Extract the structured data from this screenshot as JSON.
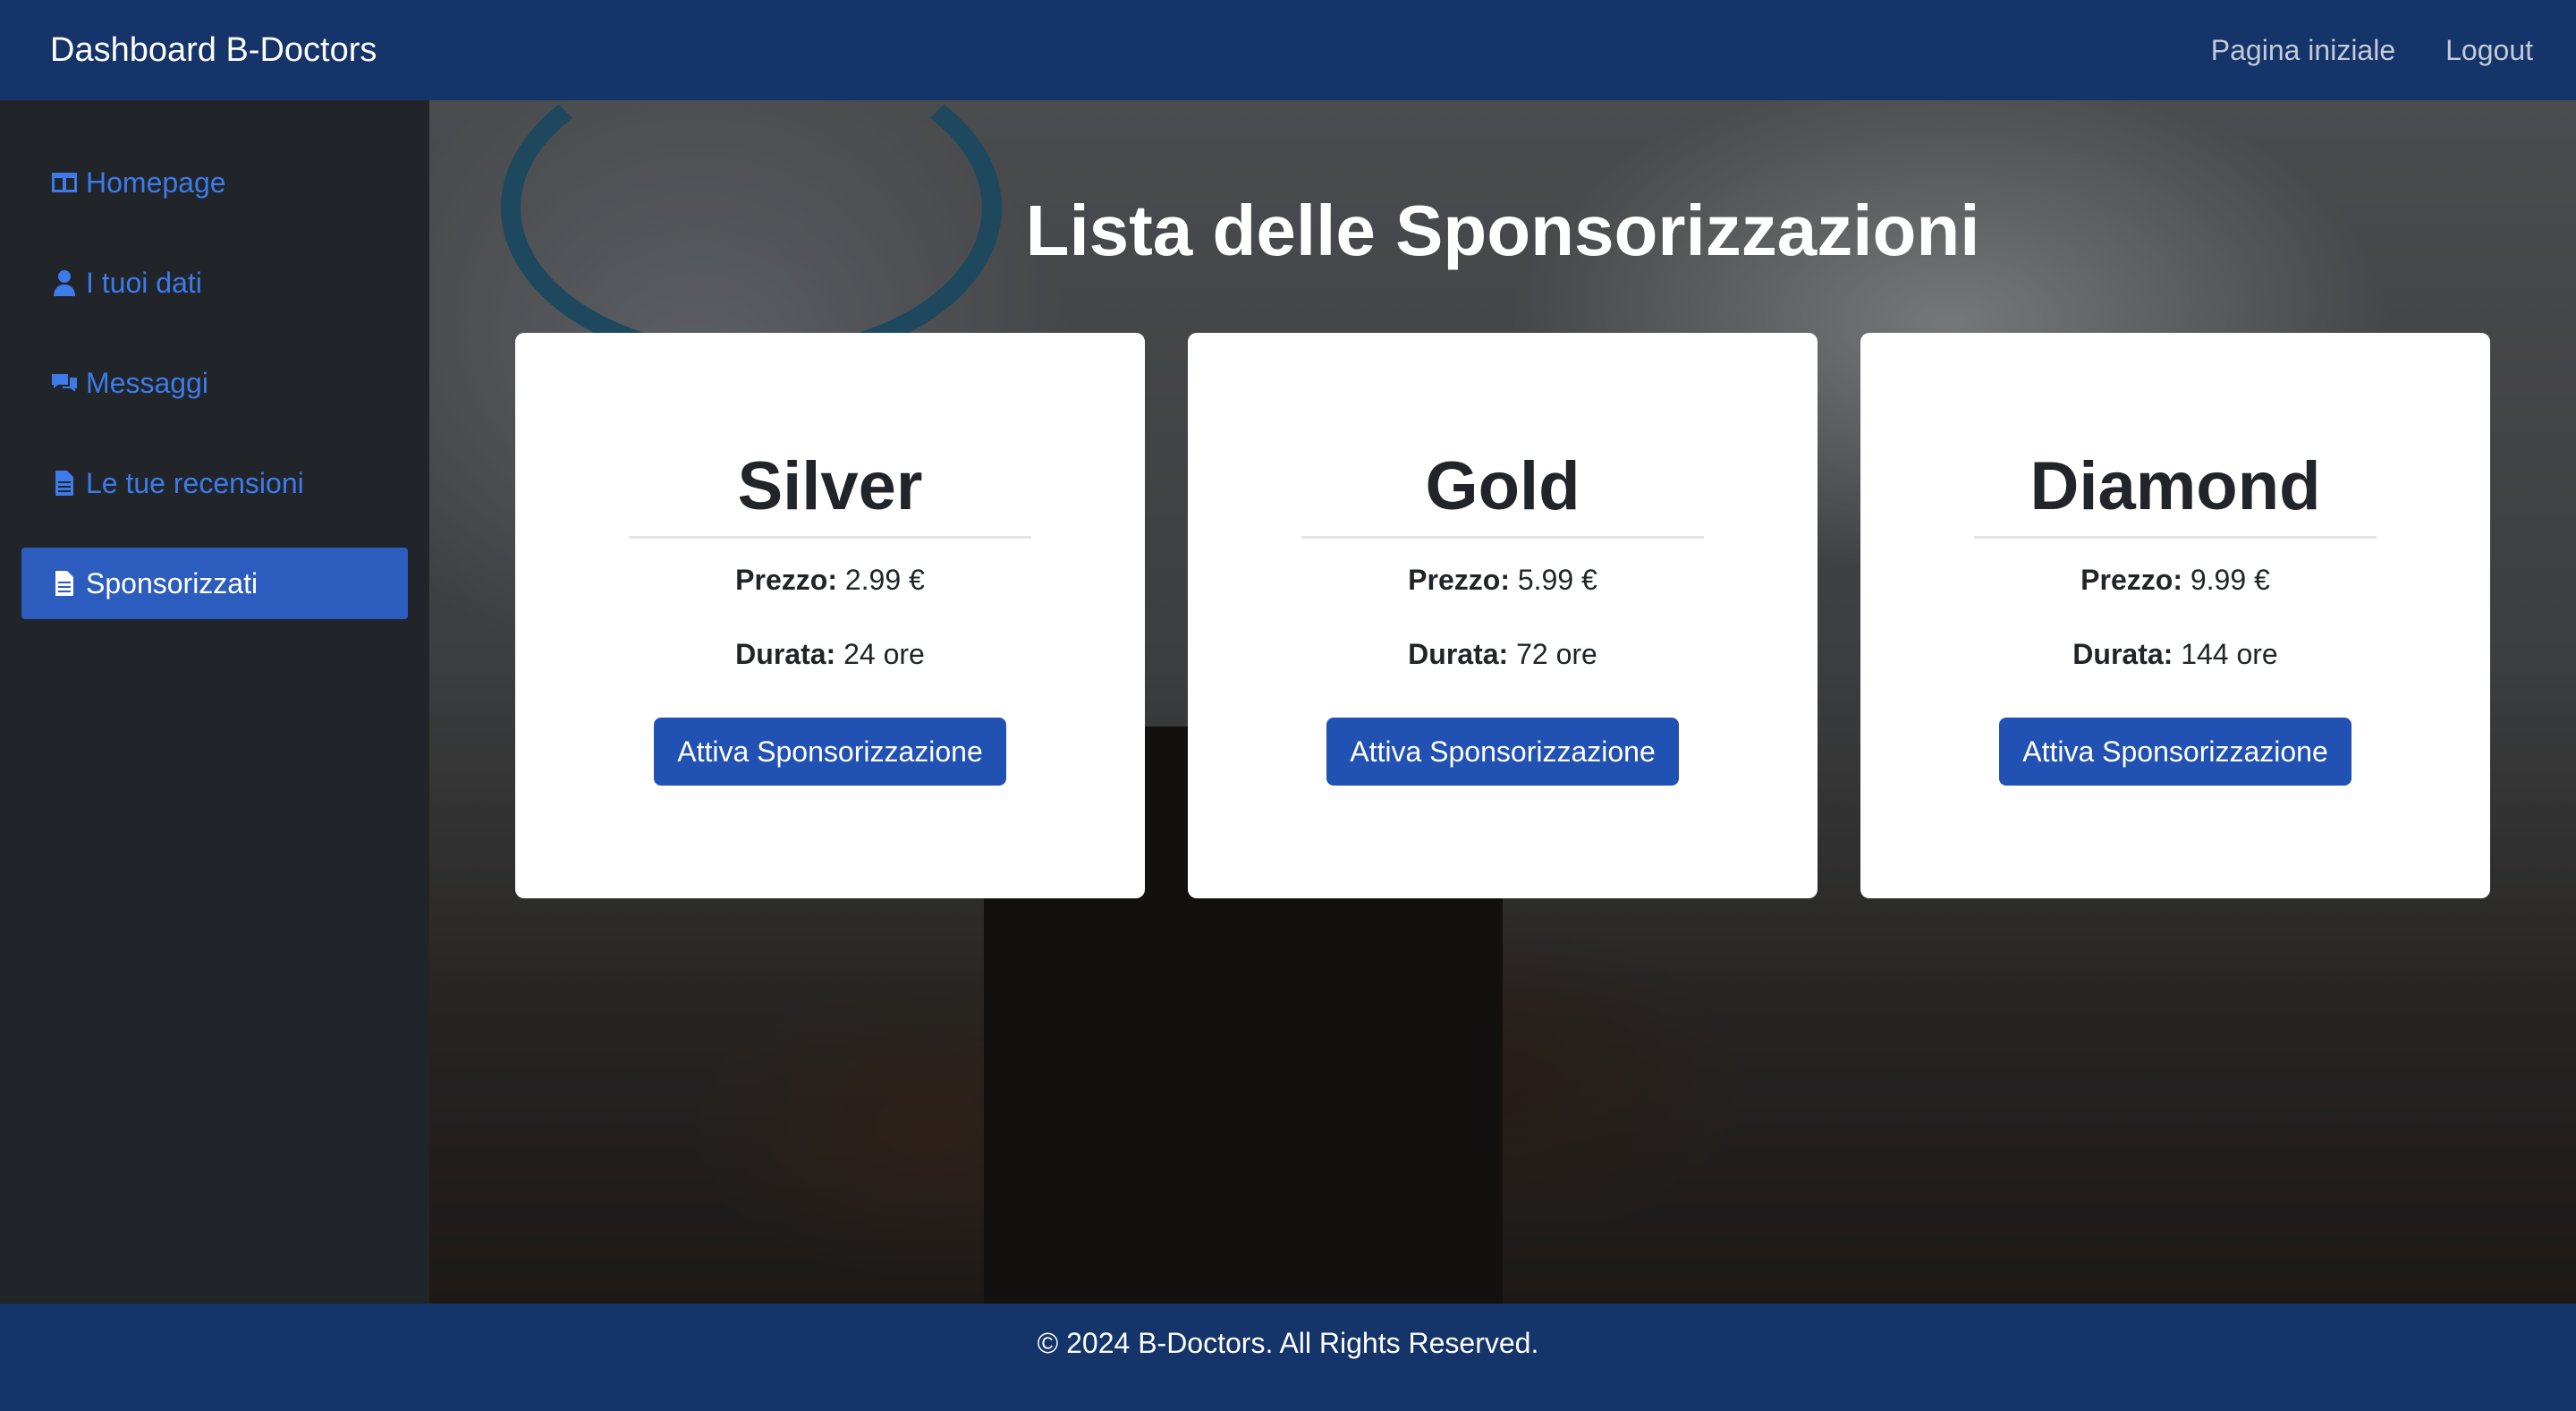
{
  "navbar": {
    "brand": "Dashboard B-Doctors",
    "links": [
      "Pagina iniziale",
      "Logout"
    ]
  },
  "sidebar": {
    "items": [
      {
        "label": "Homepage",
        "icon": "columns-icon"
      },
      {
        "label": "I tuoi dati",
        "icon": "user-doctor-icon"
      },
      {
        "label": "Messaggi",
        "icon": "comments-icon"
      },
      {
        "label": "Le tue recensioni",
        "icon": "file-icon"
      },
      {
        "label": "Sponsorizzati",
        "icon": "file-icon",
        "active": true
      }
    ]
  },
  "main": {
    "title": "Lista delle Sponsorizzazioni",
    "price_label": "Prezzo:",
    "duration_label": "Durata:",
    "plans": [
      {
        "name": "Silver",
        "price": "2.99 €",
        "duration": "24 ore",
        "button": "Attiva Sponsorizzazione"
      },
      {
        "name": "Gold",
        "price": "5.99 €",
        "duration": "72 ore",
        "button": "Attiva Sponsorizzazione"
      },
      {
        "name": "Diamond",
        "price": "9.99 €",
        "duration": "144 ore",
        "button": "Attiva Sponsorizzazione"
      }
    ]
  },
  "footer": {
    "text": "© 2024 B-Doctors. All Rights Reserved."
  },
  "colors": {
    "navbar": "#14346a",
    "sidebar": "#212529",
    "link": "#3d7bea",
    "active": "#2c5cbd",
    "button": "#2151b2"
  }
}
